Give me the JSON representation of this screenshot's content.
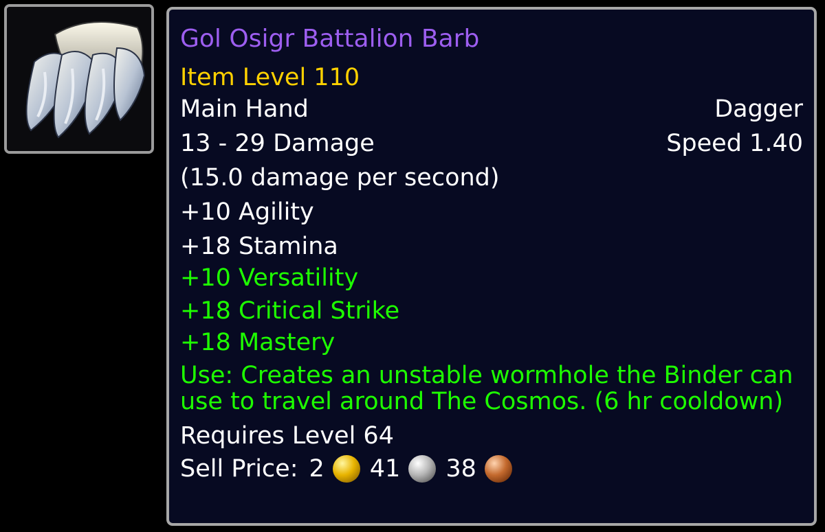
{
  "icon": {
    "name": "dagger-claw-icon"
  },
  "tooltip": {
    "item_name": "Gol Osigr Battalion Barb",
    "item_level": "Item Level 110",
    "slot": "Main Hand",
    "weapon_type": "Dagger",
    "damage": "13 - 29 Damage",
    "speed": "Speed 1.40",
    "dps": "(15.0 damage per second)",
    "stats_primary": [
      "+10 Agility",
      "+18 Stamina"
    ],
    "stats_secondary": [
      "+10 Versatility",
      "+18 Critical Strike",
      "+18 Mastery"
    ],
    "use_effect": "Use: Creates an unstable wormhole the Binder can use to travel around The Cosmos. (6 hr cooldown)",
    "requires": "Requires Level 64",
    "sell_price": {
      "label": "Sell Price:",
      "gold": "2",
      "silver": "41",
      "copper": "38"
    }
  },
  "colors": {
    "item_name": "#9d5ef0",
    "item_level": "#ffd100",
    "secondary_stat": "#1eff00",
    "tooltip_bg": "#070a22",
    "border": "#a7a7a7"
  }
}
